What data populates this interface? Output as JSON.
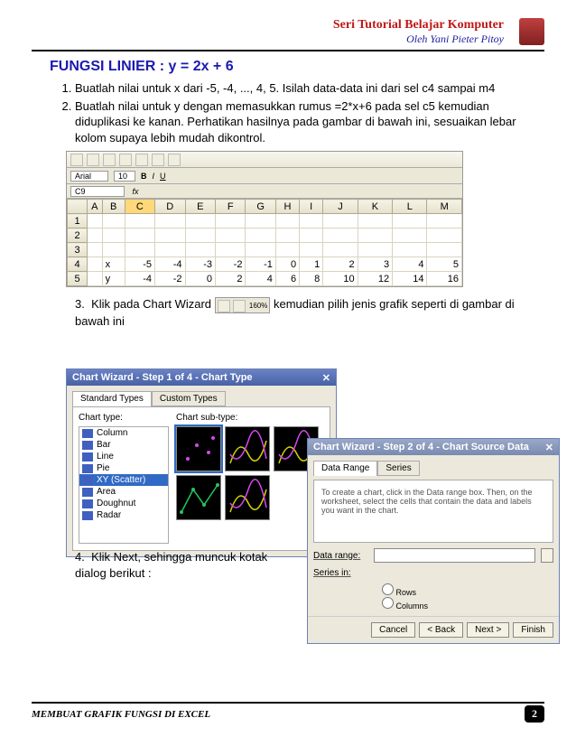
{
  "header": {
    "series": "Seri Tutorial Belajar Komputer",
    "author": "Oleh Yani Pieter Pitoy"
  },
  "title": "FUNGSI LINIER : y = 2x + 6",
  "steps": {
    "s1": "Buatlah nilai untuk x dari -5, -4, ..., 4, 5.  Isilah data-data ini dari sel c4 sampai m4",
    "s2": "Buatlah nilai untuk y dengan memasukkan rumus =2*x+6 pada sel c5 kemudian diduplikasi ke kanan. Perhatikan hasilnya pada gambar di bawah ini, sesuaikan lebar kolom supaya lebih mudah dikontrol.",
    "s3a": "Klik pada Chart Wizard",
    "s3b": "kemudian pilih jenis grafik seperti di gambar di bawah ini",
    "s4": "Klik Next, sehingga muncuk kotak dialog berikut :"
  },
  "toolbar": {
    "font": "Arial",
    "size": "10",
    "cell": "C9",
    "zoom": "160%"
  },
  "sheet": {
    "cols": [
      "",
      "A",
      "B",
      "C",
      "D",
      "E",
      "F",
      "G",
      "H",
      "I",
      "J",
      "K",
      "L",
      "M"
    ],
    "rows": [
      {
        "h": "1",
        "c": [
          "",
          "",
          "",
          "",
          "",
          "",
          "",
          "",
          "",
          "",
          "",
          "",
          ""
        ]
      },
      {
        "h": "2",
        "c": [
          "",
          "",
          "",
          "",
          "",
          "",
          "",
          "",
          "",
          "",
          "",
          "",
          ""
        ]
      },
      {
        "h": "3",
        "c": [
          "",
          "",
          "",
          "",
          "",
          "",
          "",
          "",
          "",
          "",
          "",
          "",
          ""
        ]
      },
      {
        "h": "4",
        "c": [
          "",
          "x",
          "-5",
          "-4",
          "-3",
          "-2",
          "-1",
          "0",
          "1",
          "2",
          "3",
          "4",
          "5"
        ]
      },
      {
        "h": "5",
        "c": [
          "",
          "y",
          "-4",
          "-2",
          "0",
          "2",
          "4",
          "6",
          "8",
          "10",
          "12",
          "14",
          "16"
        ]
      }
    ]
  },
  "wizard1": {
    "title": "Chart Wizard - Step 1 of 4 - Chart Type",
    "tab1": "Standard Types",
    "tab2": "Custom Types",
    "chart_type_label": "Chart type:",
    "subtype_label": "Chart sub-type:",
    "types": [
      "Column",
      "Bar",
      "Line",
      "Pie",
      "XY (Scatter)",
      "Area",
      "Doughnut",
      "Radar"
    ]
  },
  "wizard2": {
    "title": "Chart Wizard - Step 2 of 4 - Chart Source Data",
    "tab1": "Data Range",
    "tab2": "Series",
    "hint": "To create a chart, click in the Data range box. Then, on the worksheet, select the cells that contain the data and labels you want in the chart.",
    "data_range_label": "Data range:",
    "series_in_label": "Series in:",
    "rows": "Rows",
    "columns": "Columns",
    "cancel": "Cancel",
    "back": "< Back",
    "next": "Next >",
    "finish": "Finish"
  },
  "footer": {
    "text": "MEMBUAT GRAFIK FUNGSI DI EXCEL",
    "page": "2"
  },
  "chart_data": {
    "type": "line",
    "title": "y = 2x + 6",
    "xlabel": "x",
    "ylabel": "y",
    "x": [
      -5,
      -4,
      -3,
      -2,
      -1,
      0,
      1,
      2,
      3,
      4,
      5
    ],
    "series": [
      {
        "name": "y",
        "values": [
          -4,
          -2,
          0,
          2,
          4,
          6,
          8,
          10,
          12,
          14,
          16
        ]
      }
    ],
    "ylim": [
      -4,
      16
    ]
  }
}
